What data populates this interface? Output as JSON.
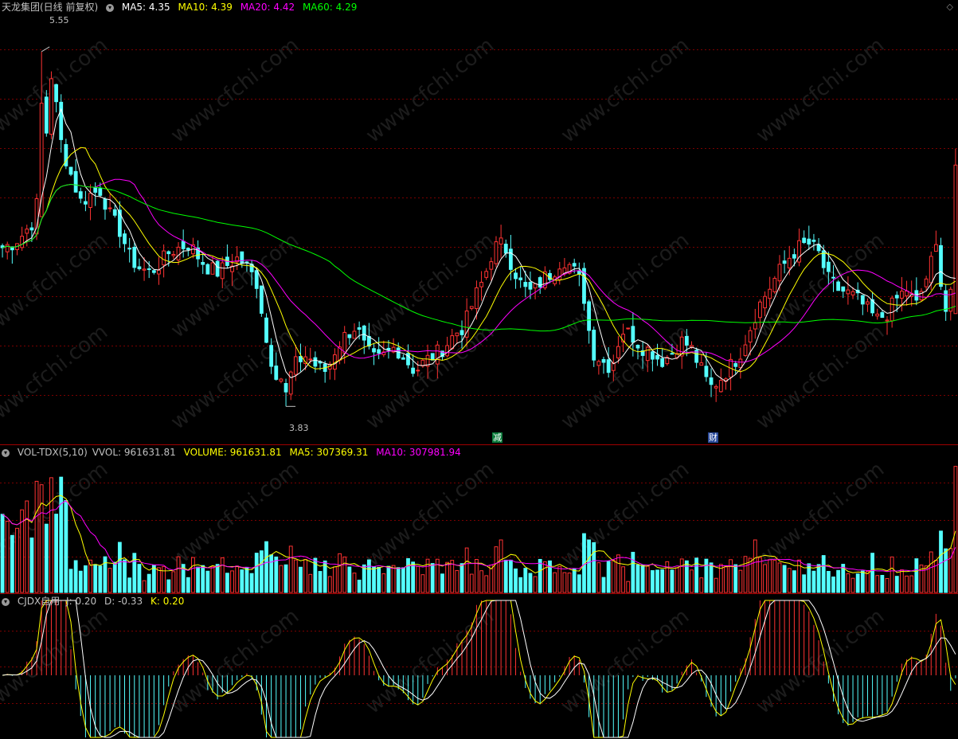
{
  "price_panel": {
    "title": "天龙集团(日线 前复权)",
    "ma5_label": "MA5: 4.35",
    "ma10_label": "MA10: 4.39",
    "ma20_label": "MA20: 4.42",
    "ma60_label": "MA60: 4.29",
    "high_label": "5.55",
    "low_label": "3.83",
    "event_1": "减",
    "event_2": "财"
  },
  "volume_panel": {
    "name_label": "VOL-TDX(5,10)",
    "vvol_label": "VVOL: 961631.81",
    "volume_label": "VOLUME: 961631.81",
    "ma5_label": "MA5: 307369.31",
    "ma10_label": "MA10: 307981.94"
  },
  "indicator_panel": {
    "name_label": "CJDX自用",
    "j_label": "J: 0.20",
    "d_label": "D: -0.33",
    "k_label": "K: 0.20"
  },
  "watermark": "www.cfchi.com",
  "colors": {
    "up": "#ff3232",
    "down": "#54ffff",
    "ma5": "#ffffff",
    "ma10": "#ffff00",
    "ma20": "#ff00ff",
    "ma60": "#00ff00",
    "grid": "#7a0000"
  },
  "chart_data": [
    {
      "type": "candlestick",
      "title": "天龙集团(日线 前复权)",
      "ylim": [
        3.7,
        5.7
      ],
      "high_marker": 5.55,
      "low_marker": 3.83,
      "series": [
        {
          "name": "MA5",
          "last": 4.35
        },
        {
          "name": "MA10",
          "last": 4.39
        },
        {
          "name": "MA20",
          "last": 4.42
        },
        {
          "name": "MA60",
          "last": 4.29
        }
      ],
      "close_path": [
        4.6,
        4.62,
        4.66,
        4.72,
        4.9,
        5.45,
        5.1,
        4.95,
        4.82,
        4.86,
        4.88,
        4.75,
        4.68,
        4.55,
        4.5,
        4.48,
        4.52,
        4.58,
        4.6,
        4.62,
        4.55,
        4.5,
        4.48,
        4.52,
        4.55,
        4.5,
        4.42,
        4.1,
        3.98,
        3.95,
        4.05,
        4.08,
        4.02,
        4.0,
        4.12,
        4.18,
        4.22,
        4.1,
        4.05,
        4.08,
        4.12,
        4.06,
        4.0,
        4.05,
        4.08,
        4.12,
        4.18,
        4.22,
        4.35,
        4.45,
        4.6,
        4.62,
        4.5,
        4.4,
        4.38,
        4.45,
        4.48,
        4.55,
        4.5,
        4.42,
        4.1,
        4.05,
        4.02,
        4.2,
        4.18,
        4.12,
        4.1,
        4.05,
        4.08,
        4.15,
        4.12,
        4.02,
        3.92,
        3.96,
        4.02,
        4.08,
        4.2,
        4.32,
        4.4,
        4.48,
        4.55,
        4.6,
        4.62,
        4.58,
        4.45,
        4.4,
        4.38,
        4.35,
        4.3,
        4.25,
        4.28,
        4.35,
        4.4,
        4.32,
        4.45,
        4.6,
        4.3,
        4.5
      ]
    },
    {
      "type": "bar",
      "title": "VOL-TDX(5,10)",
      "series": [
        {
          "name": "VVOL",
          "last": 961631.81
        },
        {
          "name": "VOLUME",
          "last": 961631.81
        },
        {
          "name": "MA5",
          "last": 307369.31
        },
        {
          "name": "MA10",
          "last": 307981.94
        }
      ],
      "ylim": [
        0,
        1000000
      ]
    },
    {
      "type": "line",
      "title": "CJDX自用",
      "series": [
        {
          "name": "J",
          "last": 0.2
        },
        {
          "name": "D",
          "last": -0.33
        },
        {
          "name": "K",
          "last": 0.2
        }
      ]
    }
  ]
}
